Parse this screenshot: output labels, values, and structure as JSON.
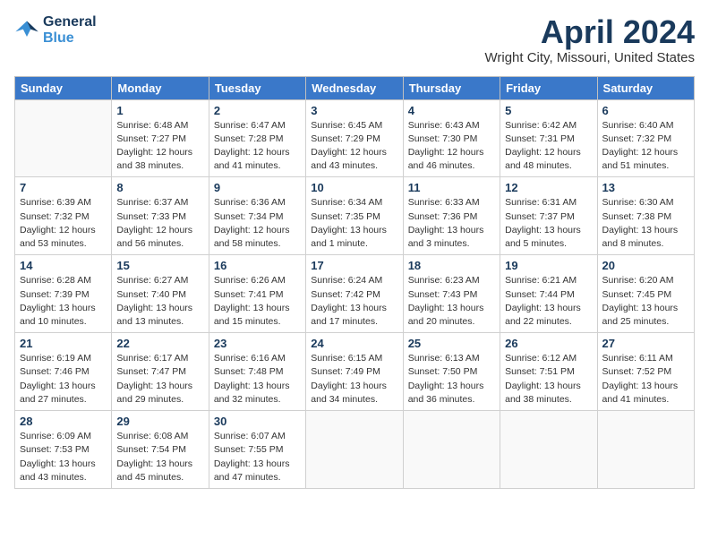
{
  "header": {
    "logo_line1": "General",
    "logo_line2": "Blue",
    "title": "April 2024",
    "subtitle": "Wright City, Missouri, United States"
  },
  "weekdays": [
    "Sunday",
    "Monday",
    "Tuesday",
    "Wednesday",
    "Thursday",
    "Friday",
    "Saturday"
  ],
  "weeks": [
    [
      {
        "day": null
      },
      {
        "day": "1",
        "sunrise": "6:48 AM",
        "sunset": "7:27 PM",
        "daylight": "12 hours and 38 minutes."
      },
      {
        "day": "2",
        "sunrise": "6:47 AM",
        "sunset": "7:28 PM",
        "daylight": "12 hours and 41 minutes."
      },
      {
        "day": "3",
        "sunrise": "6:45 AM",
        "sunset": "7:29 PM",
        "daylight": "12 hours and 43 minutes."
      },
      {
        "day": "4",
        "sunrise": "6:43 AM",
        "sunset": "7:30 PM",
        "daylight": "12 hours and 46 minutes."
      },
      {
        "day": "5",
        "sunrise": "6:42 AM",
        "sunset": "7:31 PM",
        "daylight": "12 hours and 48 minutes."
      },
      {
        "day": "6",
        "sunrise": "6:40 AM",
        "sunset": "7:32 PM",
        "daylight": "12 hours and 51 minutes."
      }
    ],
    [
      {
        "day": "7",
        "sunrise": "6:39 AM",
        "sunset": "7:32 PM",
        "daylight": "12 hours and 53 minutes."
      },
      {
        "day": "8",
        "sunrise": "6:37 AM",
        "sunset": "7:33 PM",
        "daylight": "12 hours and 56 minutes."
      },
      {
        "day": "9",
        "sunrise": "6:36 AM",
        "sunset": "7:34 PM",
        "daylight": "12 hours and 58 minutes."
      },
      {
        "day": "10",
        "sunrise": "6:34 AM",
        "sunset": "7:35 PM",
        "daylight": "13 hours and 1 minute."
      },
      {
        "day": "11",
        "sunrise": "6:33 AM",
        "sunset": "7:36 PM",
        "daylight": "13 hours and 3 minutes."
      },
      {
        "day": "12",
        "sunrise": "6:31 AM",
        "sunset": "7:37 PM",
        "daylight": "13 hours and 5 minutes."
      },
      {
        "day": "13",
        "sunrise": "6:30 AM",
        "sunset": "7:38 PM",
        "daylight": "13 hours and 8 minutes."
      }
    ],
    [
      {
        "day": "14",
        "sunrise": "6:28 AM",
        "sunset": "7:39 PM",
        "daylight": "13 hours and 10 minutes."
      },
      {
        "day": "15",
        "sunrise": "6:27 AM",
        "sunset": "7:40 PM",
        "daylight": "13 hours and 13 minutes."
      },
      {
        "day": "16",
        "sunrise": "6:26 AM",
        "sunset": "7:41 PM",
        "daylight": "13 hours and 15 minutes."
      },
      {
        "day": "17",
        "sunrise": "6:24 AM",
        "sunset": "7:42 PM",
        "daylight": "13 hours and 17 minutes."
      },
      {
        "day": "18",
        "sunrise": "6:23 AM",
        "sunset": "7:43 PM",
        "daylight": "13 hours and 20 minutes."
      },
      {
        "day": "19",
        "sunrise": "6:21 AM",
        "sunset": "7:44 PM",
        "daylight": "13 hours and 22 minutes."
      },
      {
        "day": "20",
        "sunrise": "6:20 AM",
        "sunset": "7:45 PM",
        "daylight": "13 hours and 25 minutes."
      }
    ],
    [
      {
        "day": "21",
        "sunrise": "6:19 AM",
        "sunset": "7:46 PM",
        "daylight": "13 hours and 27 minutes."
      },
      {
        "day": "22",
        "sunrise": "6:17 AM",
        "sunset": "7:47 PM",
        "daylight": "13 hours and 29 minutes."
      },
      {
        "day": "23",
        "sunrise": "6:16 AM",
        "sunset": "7:48 PM",
        "daylight": "13 hours and 32 minutes."
      },
      {
        "day": "24",
        "sunrise": "6:15 AM",
        "sunset": "7:49 PM",
        "daylight": "13 hours and 34 minutes."
      },
      {
        "day": "25",
        "sunrise": "6:13 AM",
        "sunset": "7:50 PM",
        "daylight": "13 hours and 36 minutes."
      },
      {
        "day": "26",
        "sunrise": "6:12 AM",
        "sunset": "7:51 PM",
        "daylight": "13 hours and 38 minutes."
      },
      {
        "day": "27",
        "sunrise": "6:11 AM",
        "sunset": "7:52 PM",
        "daylight": "13 hours and 41 minutes."
      }
    ],
    [
      {
        "day": "28",
        "sunrise": "6:09 AM",
        "sunset": "7:53 PM",
        "daylight": "13 hours and 43 minutes."
      },
      {
        "day": "29",
        "sunrise": "6:08 AM",
        "sunset": "7:54 PM",
        "daylight": "13 hours and 45 minutes."
      },
      {
        "day": "30",
        "sunrise": "6:07 AM",
        "sunset": "7:55 PM",
        "daylight": "13 hours and 47 minutes."
      },
      {
        "day": null
      },
      {
        "day": null
      },
      {
        "day": null
      },
      {
        "day": null
      }
    ]
  ],
  "labels": {
    "sunrise": "Sunrise:",
    "sunset": "Sunset:",
    "daylight": "Daylight:"
  }
}
